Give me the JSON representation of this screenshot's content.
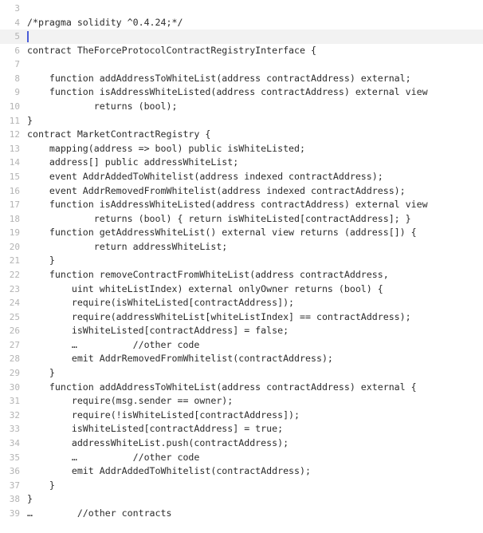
{
  "editor": {
    "language": "solidity",
    "background_color": "#ffffff",
    "text_color": "#2b2b2b",
    "gutter_color": "#b3b3b3",
    "active_line_background": "#f2f2f2",
    "caret_color": "#4a5dd8",
    "caret_line_number": 5,
    "caret_column": 0,
    "first_visible_line": 3,
    "last_visible_line": 39,
    "lines": [
      {
        "number": "3",
        "text": ""
      },
      {
        "number": "4",
        "text": "/*pragma solidity ^0.4.24;*/"
      },
      {
        "number": "5",
        "text": ""
      },
      {
        "number": "6",
        "text": "contract TheForceProtocolContractRegistryInterface {"
      },
      {
        "number": "7",
        "text": ""
      },
      {
        "number": "8",
        "text": "    function addAddressToWhiteList(address contractAddress) external;"
      },
      {
        "number": "9",
        "text": "    function isAddressWhiteListed(address contractAddress) external view"
      },
      {
        "number": "10",
        "text": "            returns (bool);"
      },
      {
        "number": "11",
        "text": "}"
      },
      {
        "number": "12",
        "text": "contract MarketContractRegistry {"
      },
      {
        "number": "13",
        "text": "    mapping(address => bool) public isWhiteListed;"
      },
      {
        "number": "14",
        "text": "    address[] public addressWhiteList;"
      },
      {
        "number": "15",
        "text": "    event AddrAddedToWhitelist(address indexed contractAddress);"
      },
      {
        "number": "16",
        "text": "    event AddrRemovedFromWhitelist(address indexed contractAddress);"
      },
      {
        "number": "17",
        "text": "    function isAddressWhiteListed(address contractAddress) external view"
      },
      {
        "number": "18",
        "text": "            returns (bool) { return isWhiteListed[contractAddress]; }"
      },
      {
        "number": "19",
        "text": "    function getAddressWhiteList() external view returns (address[]) {"
      },
      {
        "number": "20",
        "text": "            return addressWhiteList;"
      },
      {
        "number": "21",
        "text": "    }"
      },
      {
        "number": "22",
        "text": "    function removeContractFromWhiteList(address contractAddress,"
      },
      {
        "number": "23",
        "text": "        uint whiteListIndex) external onlyOwner returns (bool) {"
      },
      {
        "number": "24",
        "text": "        require(isWhiteListed[contractAddress]);"
      },
      {
        "number": "25",
        "text": "        require(addressWhiteList[whiteListIndex] == contractAddress);"
      },
      {
        "number": "26",
        "text": "        isWhiteListed[contractAddress] = false;"
      },
      {
        "number": "27",
        "text": "        …          //other code"
      },
      {
        "number": "28",
        "text": "        emit AddrRemovedFromWhitelist(contractAddress);"
      },
      {
        "number": "29",
        "text": "    }"
      },
      {
        "number": "30",
        "text": "    function addAddressToWhiteList(address contractAddress) external {"
      },
      {
        "number": "31",
        "text": "        require(msg.sender == owner);"
      },
      {
        "number": "32",
        "text": "        require(!isWhiteListed[contractAddress]);"
      },
      {
        "number": "33",
        "text": "        isWhiteListed[contractAddress] = true;"
      },
      {
        "number": "34",
        "text": "        addressWhiteList.push(contractAddress);"
      },
      {
        "number": "35",
        "text": "        …          //other code"
      },
      {
        "number": "36",
        "text": "        emit AddrAddedToWhitelist(contractAddress);"
      },
      {
        "number": "37",
        "text": "    }"
      },
      {
        "number": "38",
        "text": "}"
      },
      {
        "number": "39",
        "text": "…        //other contracts"
      }
    ]
  }
}
